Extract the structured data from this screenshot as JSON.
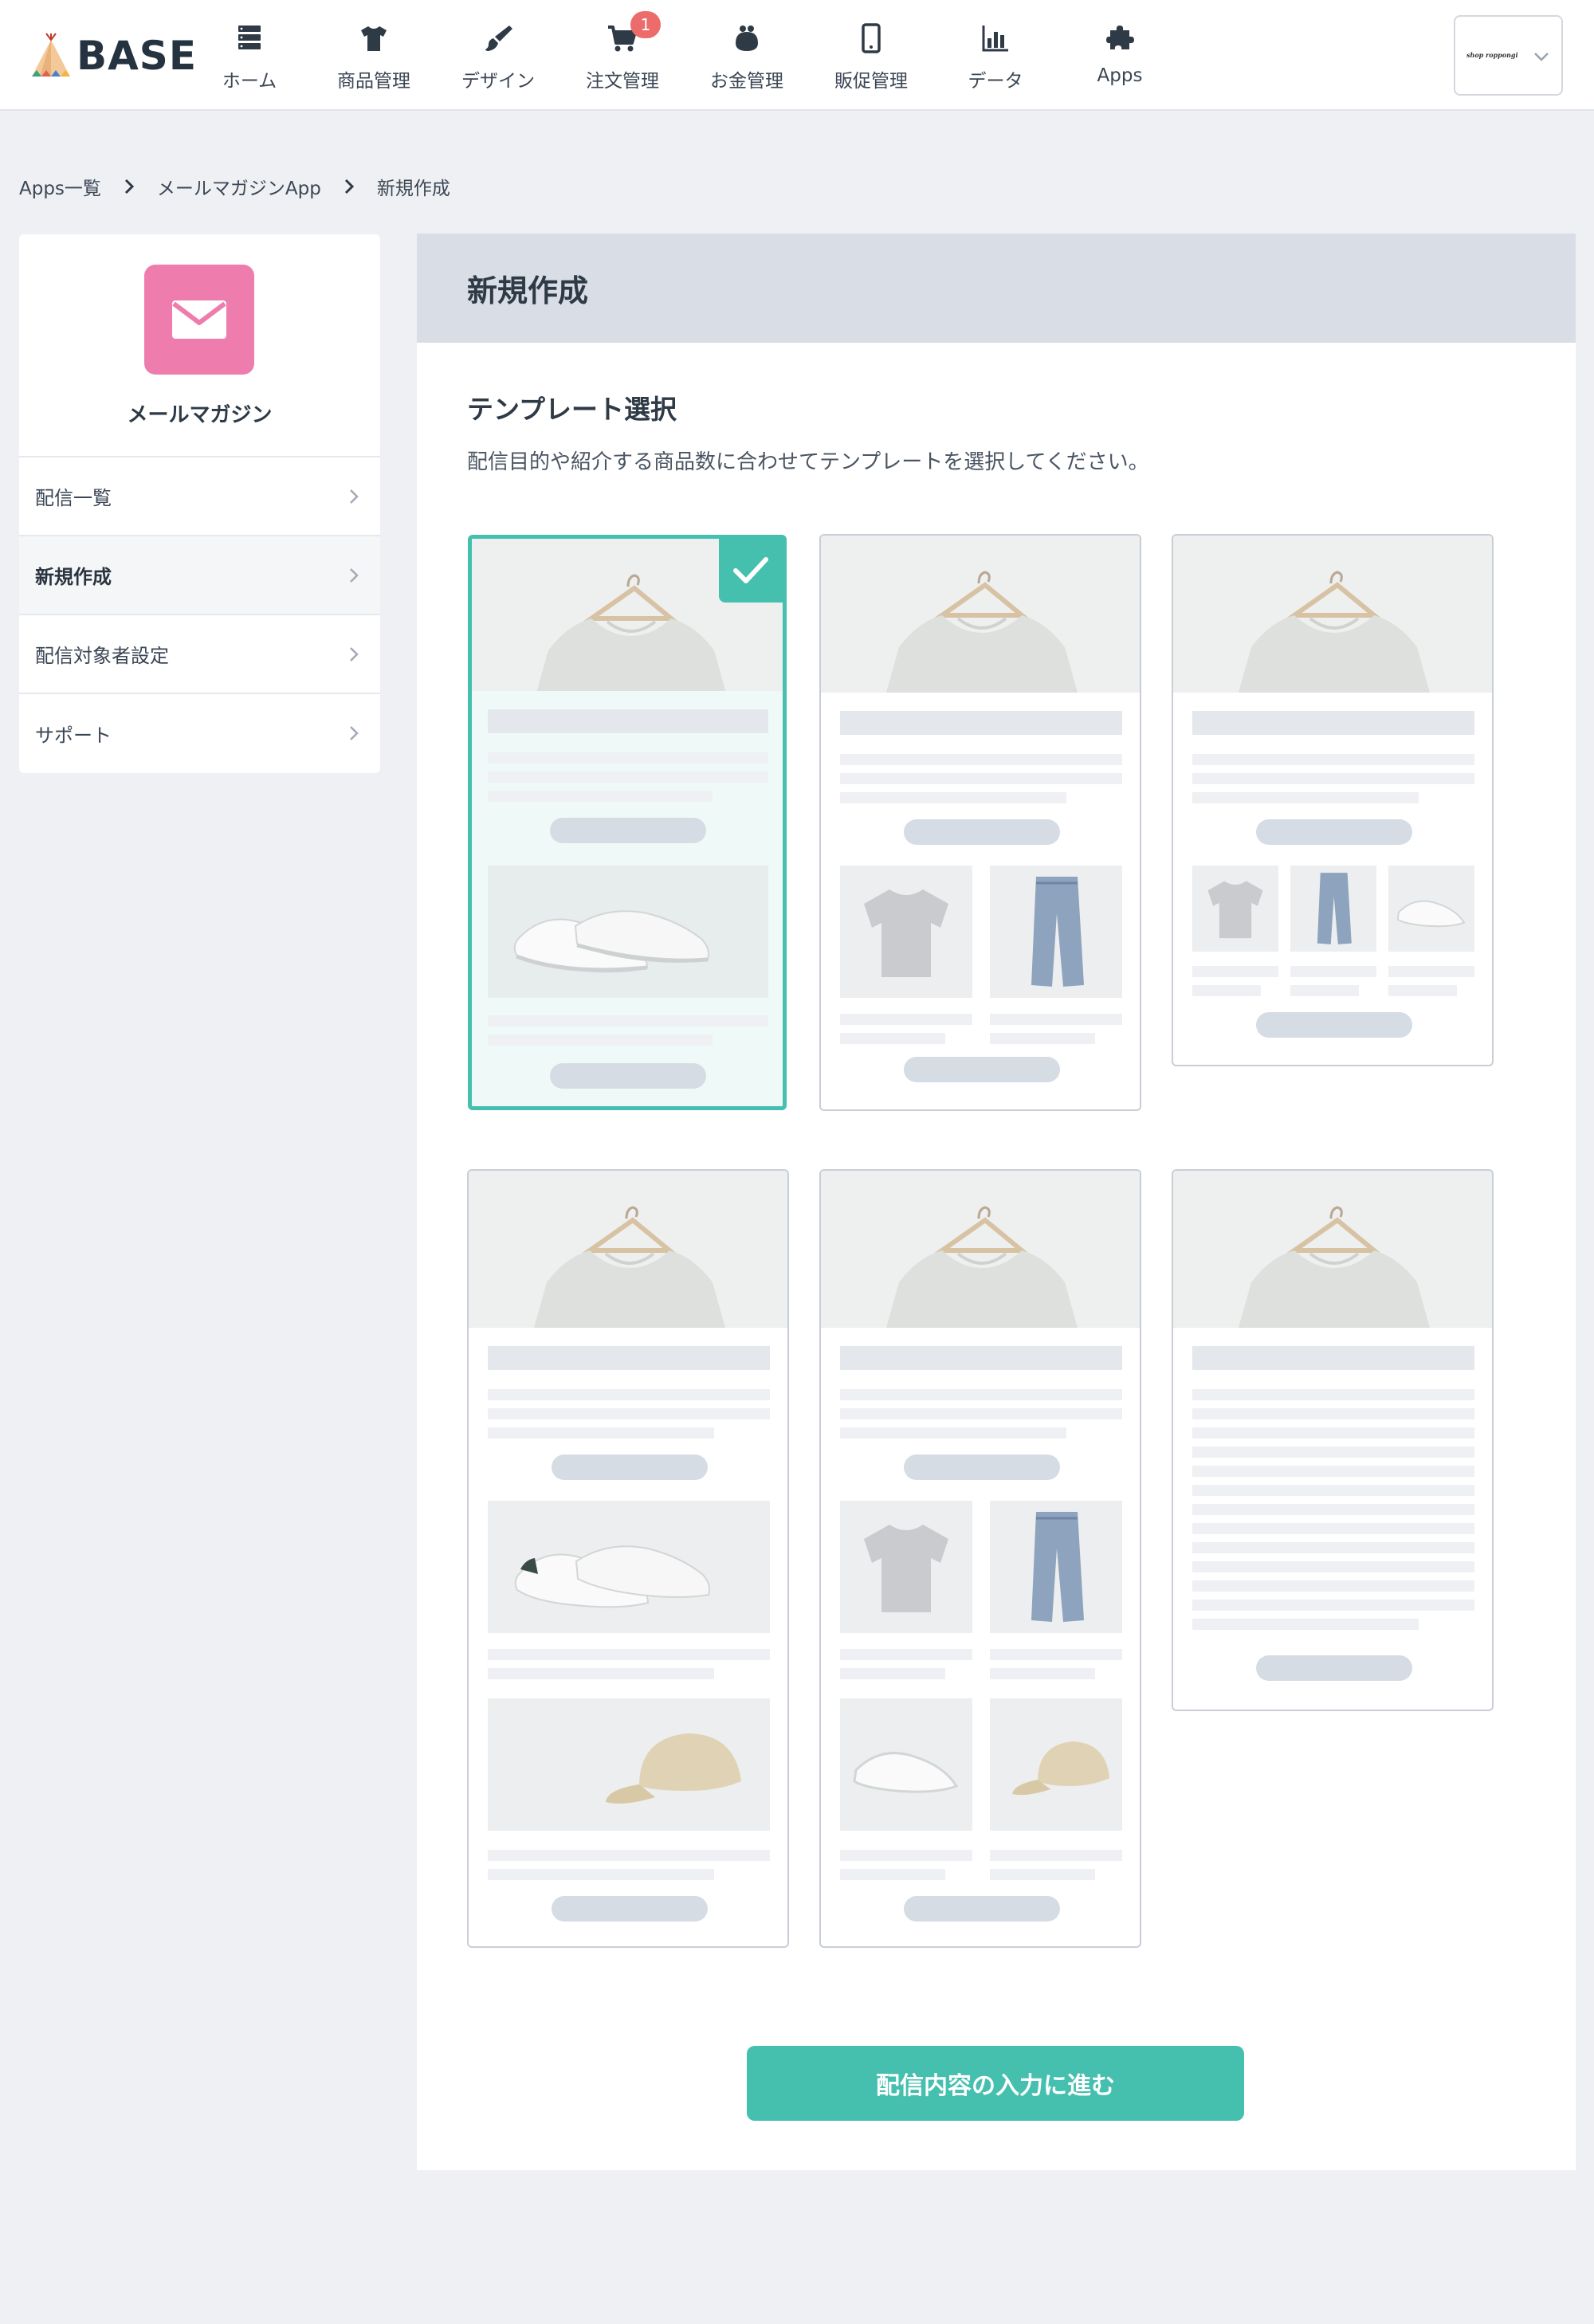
{
  "header": {
    "logo_text": "BASE",
    "nav": [
      {
        "label": "ホーム",
        "icon": "server-icon"
      },
      {
        "label": "商品管理",
        "icon": "tshirt-icon"
      },
      {
        "label": "デザイン",
        "icon": "brush-icon"
      },
      {
        "label": "注文管理",
        "icon": "cart-icon",
        "badge": "1"
      },
      {
        "label": "お金管理",
        "icon": "purse-icon"
      },
      {
        "label": "販促管理",
        "icon": "smartphone-icon"
      },
      {
        "label": "データ",
        "icon": "bar-chart-icon"
      },
      {
        "label": "Apps",
        "icon": "puzzle-icon"
      }
    ],
    "shop_name": "shop roppongi"
  },
  "breadcrumb": [
    "Apps一覧",
    "メールマガジンApp",
    "新規作成"
  ],
  "sidebar": {
    "app_title": "メールマガジン",
    "items": [
      {
        "label": "配信一覧",
        "active": false
      },
      {
        "label": "新規作成",
        "active": true
      },
      {
        "label": "配信対象者設定",
        "active": false
      },
      {
        "label": "サポート",
        "active": false
      }
    ]
  },
  "main": {
    "title": "新規作成",
    "section_title": "テンプレート選択",
    "section_desc": "配信目的や紹介する商品数に合わせてテンプレートを選択してください。",
    "selected_template": 1,
    "cta_label": "配信内容の入力に進む"
  },
  "colors": {
    "accent": "#45bfae",
    "app_icon": "#ee7cad",
    "badge": "#ec6b6b",
    "header_band": "#d9dee6"
  }
}
